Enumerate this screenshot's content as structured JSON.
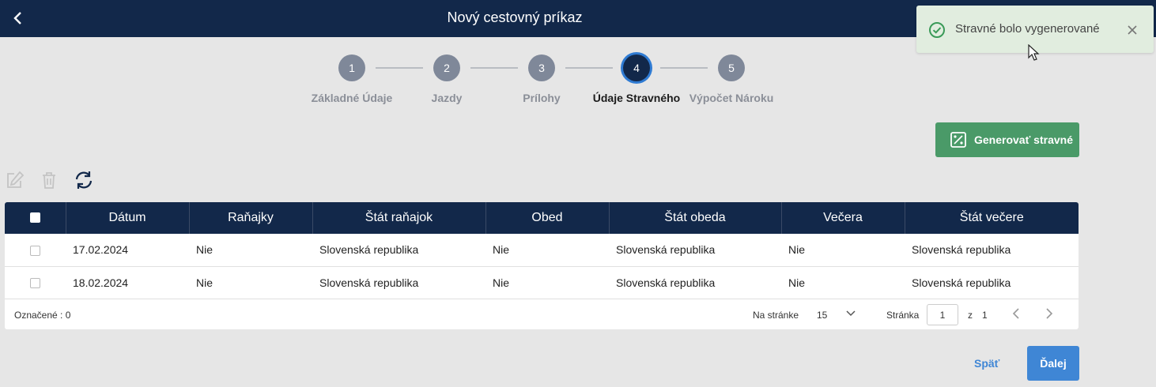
{
  "header": {
    "title": "Nový cestovný príkaz"
  },
  "toast": {
    "message": "Stravné bolo vygenerované",
    "color": "#e1eddf"
  },
  "steps": [
    {
      "number": "1",
      "label": "Základné Údaje",
      "active": false
    },
    {
      "number": "2",
      "label": "Jazdy",
      "active": false
    },
    {
      "number": "3",
      "label": "Prílohy",
      "active": false
    },
    {
      "number": "4",
      "label": "Údaje Stravného",
      "active": true
    },
    {
      "number": "5",
      "label": "Výpočet Nároku",
      "active": false
    }
  ],
  "actions": {
    "generate_label": "Generovať stravné"
  },
  "toolbar": {
    "icons": [
      "edit-icon",
      "trash-icon",
      "refresh-icon"
    ]
  },
  "table": {
    "columns": [
      "Dátum",
      "Raňajky",
      "Štát raňajok",
      "Obed",
      "Štát obeda",
      "Večera",
      "Štát večere"
    ],
    "rows": [
      [
        "17.02.2024",
        "Nie",
        "Slovenská republika",
        "Nie",
        "Slovenská republika",
        "Nie",
        "Slovenská republika"
      ],
      [
        "18.02.2024",
        "Nie",
        "Slovenská republika",
        "Nie",
        "Slovenská republika",
        "Nie",
        "Slovenská republika"
      ]
    ]
  },
  "footer": {
    "marked": "Označené : 0",
    "per_page_label": "Na stránke",
    "per_page_value": "15",
    "page_label": "Stránka",
    "page_value": "1",
    "of_label": "z",
    "total_pages": "1"
  },
  "nav": {
    "back_label": "Späť",
    "next_label": "Ďalej"
  },
  "colors": {
    "header": "#12284a",
    "primary": "#3f86d5",
    "success": "#4a9a68"
  }
}
